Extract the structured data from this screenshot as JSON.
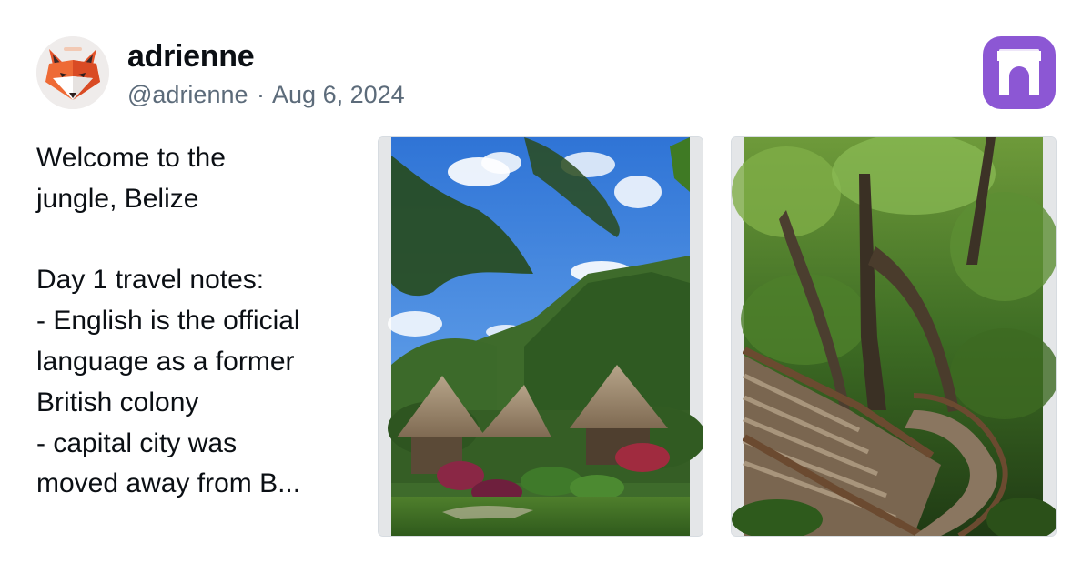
{
  "author": {
    "display_name": "adrienne",
    "handle": "@adrienne",
    "date": "Aug 6, 2024",
    "separator": "·",
    "avatar_icon": "fox-avatar-icon"
  },
  "app": {
    "logo_icon": "archway-logo-icon",
    "brand_color": "#8c57d4"
  },
  "post": {
    "text": "Welcome to the\njungle, Belize\n\nDay 1 travel notes:\n- English is the official\nlanguage as a former\nBritish colony\n- capital city was\nmoved away from B..."
  },
  "photos": [
    {
      "subject": "thatched-huts-jungle-photo"
    },
    {
      "subject": "wooden-stairs-forest-photo"
    }
  ],
  "colors": {
    "text_primary": "#0b0f14",
    "text_secondary": "#5c6b7a",
    "photo_border": "#d7dce1"
  }
}
